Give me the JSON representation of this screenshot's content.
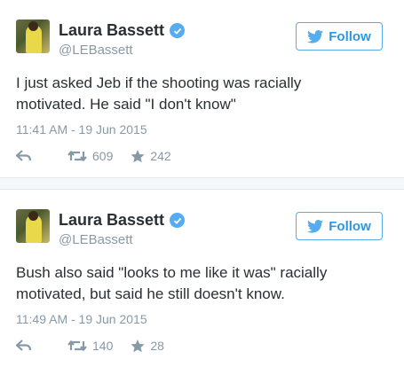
{
  "tweets": [
    {
      "author_name": "Laura Bassett",
      "handle": "@LEBassett",
      "follow_label": "Follow",
      "text_line1": "I just asked Jeb if the shooting was racially",
      "text_line2": "motivated. He said \"I don't know\"",
      "timestamp": "11:41 AM - 19 Jun 2015",
      "retweets": "609",
      "favorites": "242"
    },
    {
      "author_name": "Laura Bassett",
      "handle": "@LEBassett",
      "follow_label": "Follow",
      "text_line1": "Bush also said \"looks to me like it was\" racially",
      "text_line2": "motivated, but said he still doesn't know.",
      "timestamp": "11:49 AM - 19 Jun 2015",
      "retweets": "140",
      "favorites": "28"
    }
  ],
  "colors": {
    "accent": "#55acee",
    "meta": "#8899a6",
    "text": "#292f33"
  },
  "icons": [
    "verified-badge-icon",
    "bird-icon",
    "reply-icon",
    "retweet-icon",
    "favorite-star-icon"
  ]
}
